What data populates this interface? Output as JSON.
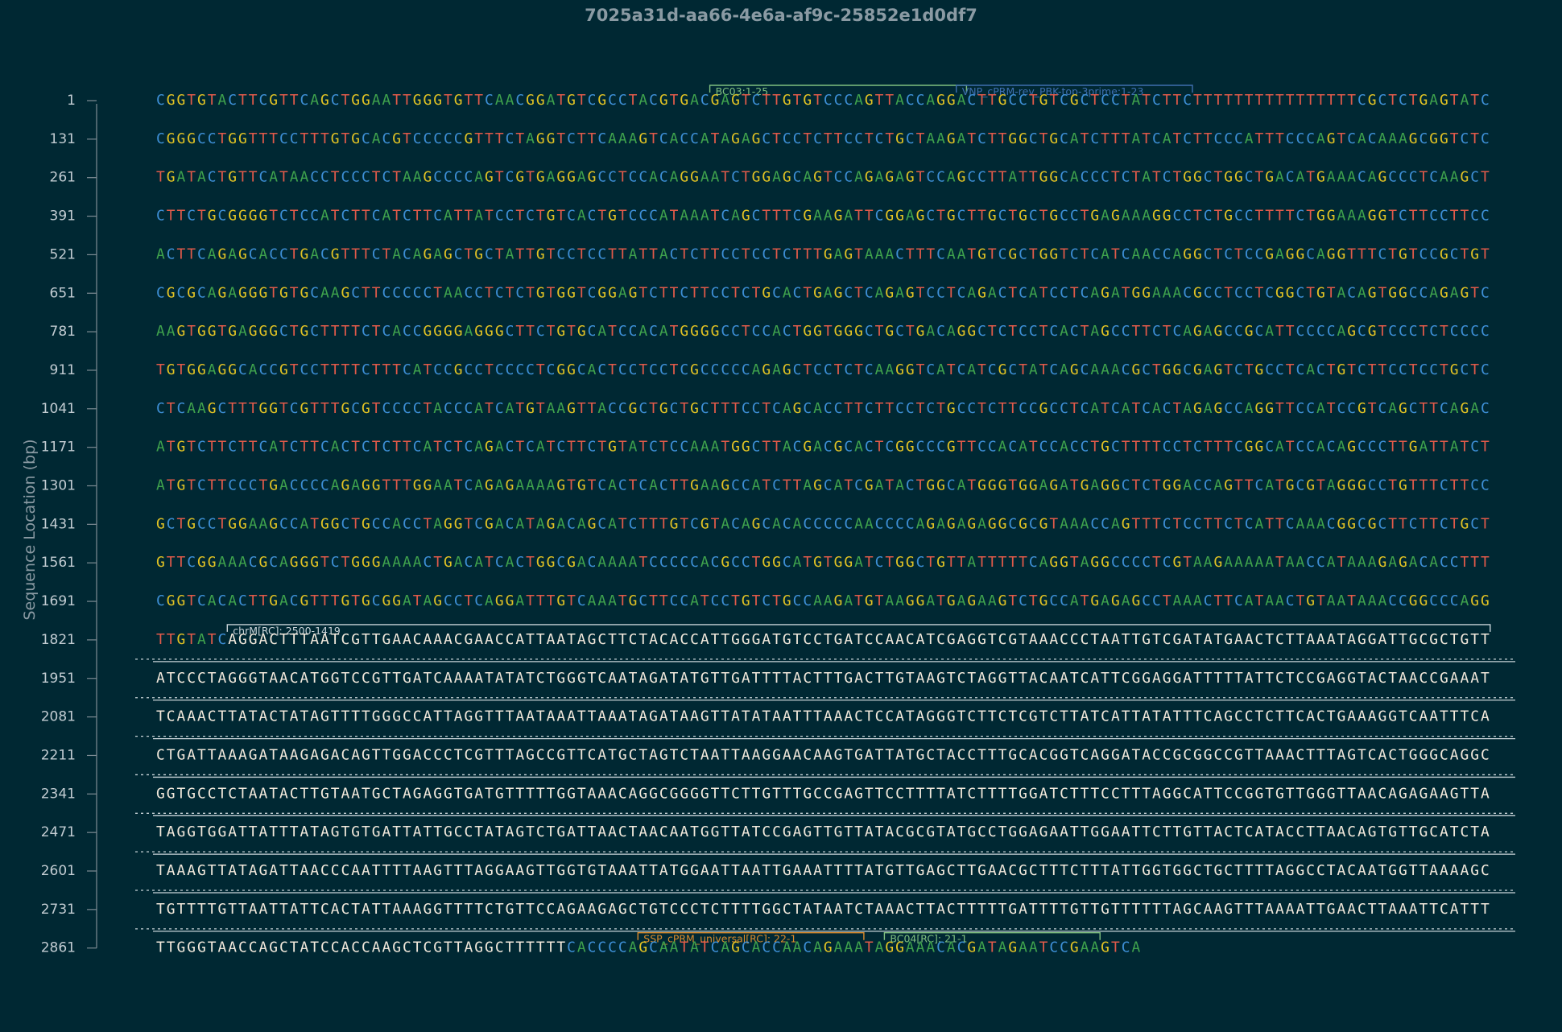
{
  "title": "7025a31d-aa66-4e6a-af9c-25852e1d0df7",
  "y_axis_label": "Sequence Location (bp)",
  "colors": {
    "background": "#002833",
    "A": "#3fa34d",
    "C": "#3d8fd6",
    "G": "#e2c324",
    "T": "#e05a4a",
    "insert_text": "#f2e9dc",
    "insert_rule": "#c8d3d8",
    "axis": "#7e8c94"
  },
  "sequence_rows": [
    {
      "start": "1",
      "seq": "CGGTGTACTTCGTTCAGCTGGAATTGGGTGTTCAACGGATGTCGCCTACGTGACGAGTCTTGTGTCCCAGTTACCAGGACTTGCCTGTCGCTCCTATCTTCTTTTTTTTTTTTTTTTCGCTCTGAGTATC",
      "insert": false
    },
    {
      "start": "131",
      "seq": "CGGGCCTGGTTTCCTTTGTGCACGTCCCCCGTTTCTAGGTCTTCAAAGTCACCATAGAGCTCCTCTTCCTCTGCTAAGATCTTGGCTGCATCTTTATCATCTTCCCATTTCCCAGTCACAAAGCGGTCTC",
      "insert": false
    },
    {
      "start": "261",
      "seq": "TGATACTGTTCATAACCTCCCTCTAAGCCCCAGTCGTGAGGAGCCTCCACAGGAATCTGGAGCAGTCCAGAGAGTCCAGCCTTATTGGCACCCTCTATCTGGCTGGCTGACATGAAACAGCCCTCAAGCT",
      "insert": false
    },
    {
      "start": "391",
      "seq": "CTTCTGCGGGGTCTCCATCTTCATCTTCATTATCCTCTGTCACTGTCCCATAAATCAGCTTTCGAAGATTCGGAGCTGCTTGCTGCTGCCTGAGAAAGGCCTCTGCCTTTTCTGGAAAGGTCTTCCTTCC",
      "insert": false
    },
    {
      "start": "521",
      "seq": "ACTTCAGAGCACCTGACGTTTCTACAGAGCTGCTATTGTCCTCCTTATTACTCTTCCTCCTCTTTGAGTAAACTTTCAATGTCGCTGGTCTCATCAACCAGGCTCTCCGAGGCAGGTTTCTGTCCGCTGT",
      "insert": false
    },
    {
      "start": "651",
      "seq": "CGCGCAGAGGGTGTGCAAGCTTCCCCCTAACCTCTCTGTGGTCGGAGTCTTCTTCCTCTGCACTGAGCTCAGAGTCCTCAGACTCATCCTCAGATGGAAACGCCTCCTCGGCTGTACAGTGGCCAGAGTC",
      "insert": false
    },
    {
      "start": "781",
      "seq": "AAGTGGTGAGGGCTGCTTTTCTCACCGGGGAGGGCTTCTGTGCATCCACATGGGGCCTCCACTGGTGGGCTGCTGACAGGCTCTCCTCACTAGCCTTCTCAGAGCCGCATTCCCCAGCGTCCCTCTCCCC",
      "insert": false
    },
    {
      "start": "911",
      "seq": "TGTGGAGGCACCGTCCTTTTCTTTCATCCGCCTCCCCTCGGCACTCCTCCTCGCCCCCAGAGCTCCTCTCAAGGTCATCATCGCTATCAGCAAACGCTGGCGAGTCTGCCTCACTGTCTTCCTCCTGCTC",
      "insert": false
    },
    {
      "start": "1041",
      "seq": "CTCAAGCTTTGGTCGTTTGCGTCCCCTACCCATCATGTAAGTTACCGCTGCTGCTTTCCTCAGCACCTTCTTCCTCTGCCTCTTCCGCCTCATCATCACTAGAGCCAGGTTCCATCCGTCAGCTTCAGAC",
      "insert": false
    },
    {
      "start": "1171",
      "seq": "ATGTCTTCTTCATCTTCACTCTCTTCATCTCAGACTCATCTTCTGTATCTCCAAATGGCTTACGACGCACTCGGCCCGTTCCACATCCACCTGCTTTTCCTCTTTCGGCATCCACAGCCCTTGATTATCT",
      "insert": false
    },
    {
      "start": "1301",
      "seq": "ATGTCTTCCCTGACCCCAGAGGTTTGGAATCAGAGAAAAGTGTCACTCACTTGAAGCCATCTTAGCATCGATACTGGCATGGGTGGAGATGAGGCTCTGGACCAGTTCATGCGTAGGGCCTGTTTCTTCC",
      "insert": false
    },
    {
      "start": "1431",
      "seq": "GCTGCCTGGAAGCCATGGCTGCCACCTAGGTCGACATAGACAGCATCTTTGTCGTACAGCACACCCCCAACCCCAGAGAGAGGCGCGTAAACCAGTTTCTCCTTCTCATTCAAACGGCGCTTCTTCTGCT",
      "insert": false
    },
    {
      "start": "1561",
      "seq": "GTTCGGAAACGCAGGGTCTGGGAAAACTGACATCACTGGCGACAAAATCCCCCACGCCTGGCATGTGGATCTGGCTGTTATTTTTCAGGTAGGCCCCTCGTAAGAAAAATAACCATAAAGAGACACCTTT",
      "insert": false
    },
    {
      "start": "1691",
      "seq": "CGGTCACACTTGACGTTTGTGCGGATAGCCTCAGGATTTGTCAAATGCTTCCATCCTGTCTGCCAAGATGTAAGGATGAGAAGTCTGCCATGAGAGCCTAAACTTCATAACTGTAATAAACCGGCCCAGG",
      "insert": false
    },
    {
      "start": "1821",
      "seq": "TTGTATCAGGACTTTAATCGTTGAACAAACGAACCATTAATAGCTTCTACACCATTGGGATGTCCTGATCCAACATCGAGGTCGTAAACCCTAATTGTCGATATGAACTCTTAAATAGGATTGCGCTGTT",
      "insert": true,
      "insert_from": 7
    },
    {
      "start": "1951",
      "seq": "ATCCCTAGGGTAACATGGTCCGTTGATCAAAATATATCTGGGTCAATAGATATGTTGATTTTACTTTGACTTGTAAGTCTAGGTTACAATCATTCGGAGGATTTTTATTCTCCGAGGTACTAACCGAAAT",
      "insert": true,
      "insert_from": 0
    },
    {
      "start": "2081",
      "seq": "TCAAACTTATACTATAGTTTTGGGCCATTAGGTTTAATAAATTAAATAGATAAGTTATATAATTTAAACTCCATAGGGTCTTCTCGTCTTATCATTATATTTCAGCCTCTTCACTGAAAGGTCAATTTCA",
      "insert": true,
      "insert_from": 0
    },
    {
      "start": "2211",
      "seq": "CTGATTAAAGATAAGAGACAGTTGGACCCTCGTTTAGCCGTTCATGCTAGTCTAATTAAGGAACAAGTGATTATGCTACCTTTGCACGGTCAGGATACCGCGGCCGTTAAACTTTAGTCACTGGGCAGGC",
      "insert": true,
      "insert_from": 0
    },
    {
      "start": "2341",
      "seq": "GGTGCCTCTAATACTTGTAATGCTAGAGGTGATGTTTTTGGTAAACAGGCGGGGTTCTTGTTTGCCGAGTTCCTTTTATCTTTTGGATCTTTCCTTTAGGCATTCCGGTGTTGGGTTAACAGAGAAGTTA",
      "insert": true,
      "insert_from": 0
    },
    {
      "start": "2471",
      "seq": "TAGGTGGATTATTTATAGTGTGATTATTGCCTATAGTCTGATTAACTAACAATGGTTATCCGAGTTGTTATACGCGTATGCCTGGAGAATTGGAATTCTTGTTACTCATACCTTAACAGTGTTGCATCTA",
      "insert": true,
      "insert_from": 0
    },
    {
      "start": "2601",
      "seq": "TAAAGTTATAGATTAACCCAATTTTAAGTTTAGGAAGTTGGTGTAAATTATGGAATTAATTGAAATTTTATGTTGAGCTTGAACGCTTTCTTTATTGGTGGCTGCTTTTAGGCCTACAATGGTTAAAAGC",
      "insert": true,
      "insert_from": 0
    },
    {
      "start": "2731",
      "seq": "TGTTTTGTTAATTATTCACTATTAAAGGTTTTCTGTTCCAGAAGAGCTGTCCCTCTTTTGGCTATAATCTAAACTTACTTTTTGATTTTGTTGTTTTTTAGCAAGTTTAAAATTGAACTTAAATTCATTT",
      "insert": true,
      "insert_from": 0
    },
    {
      "start": "2861",
      "seq": "TTGGGTAACCAGCTATCCACCAAGCTCGTTAGGCTTTTTTCACCCCAGCAATATCAGCACCAACAGAAATAGGAAACACGATAGAATCCGAAGTCA",
      "insert": true,
      "insert_to": 39
    }
  ],
  "features": [
    {
      "label": "BC03:1-25",
      "row": 0,
      "from": 54,
      "to": 78,
      "color": "#7fbf7f"
    },
    {
      "label": "VNP_cPRM-rev_PBK-top-3prime:1-23",
      "row": 0,
      "from": 78,
      "to": 100,
      "color": "#3f6fb0"
    },
    {
      "label": "chrM[RC]: 2500-1419",
      "row": 14,
      "from": 7,
      "to": 129,
      "color": "#c8d3d8"
    },
    {
      "label": "SSP_cPRM_universal[RC]: 22-1",
      "row": 22,
      "from": 47,
      "to": 68,
      "color": "#d98a2b"
    },
    {
      "label": "BC04[RC]: 21-1",
      "row": 22,
      "from": 71,
      "to": 91,
      "color": "#7fbf7f"
    }
  ]
}
